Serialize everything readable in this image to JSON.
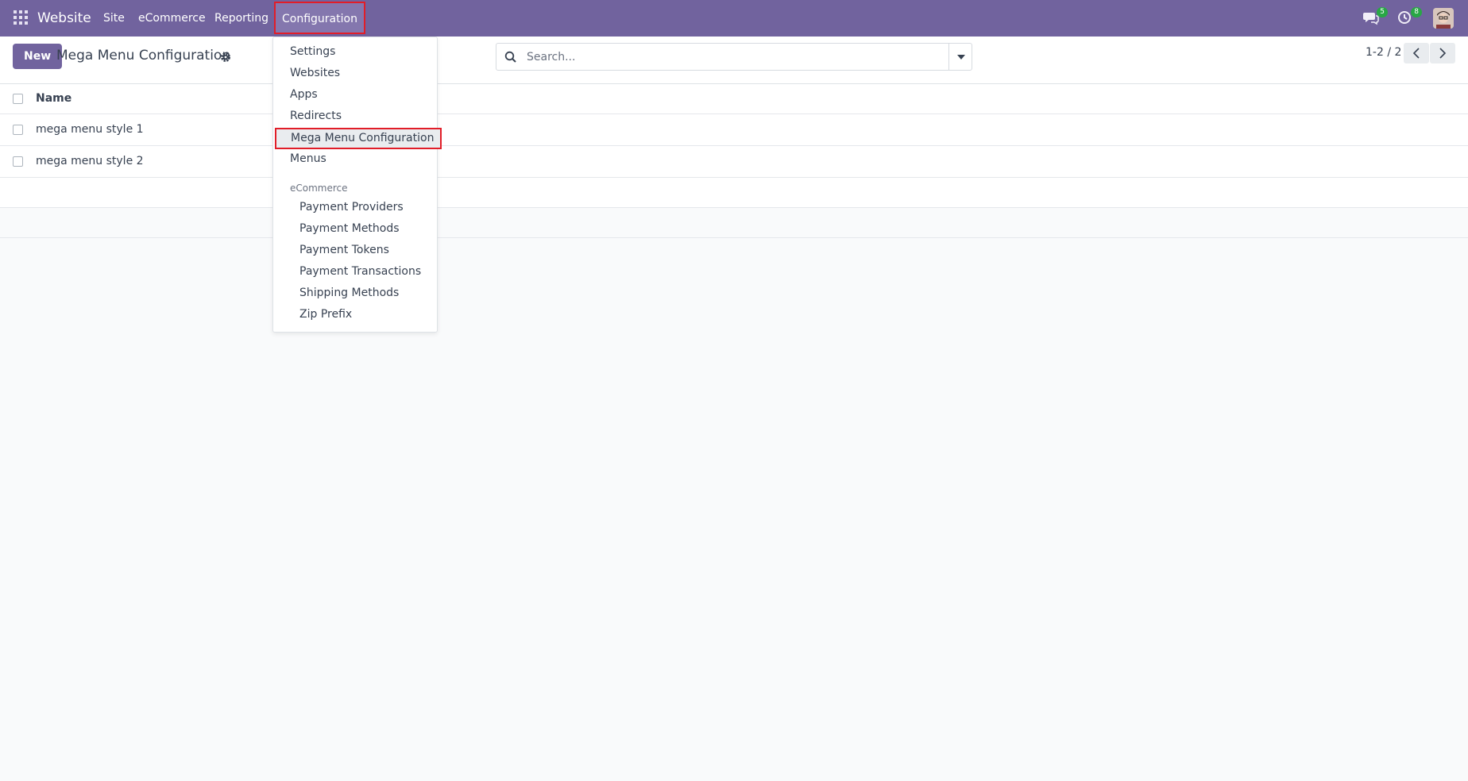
{
  "navbar": {
    "brand": "Website",
    "items": [
      "Site",
      "eCommerce",
      "Reporting",
      "Configuration"
    ],
    "active_item": "Configuration",
    "messages_badge": "5",
    "activities_badge": "8",
    "accent_color": "#71639e",
    "highlight_color": "#e11d28"
  },
  "control_panel": {
    "new_label": "New",
    "title": "Mega Menu Configuration",
    "search_placeholder": "Search...",
    "pager": "1-2 / 2"
  },
  "list": {
    "columns": [
      "Name"
    ],
    "rows": [
      {
        "name": "mega menu style 1"
      },
      {
        "name": "mega menu style 2"
      }
    ]
  },
  "dropdown": {
    "items": [
      "Settings",
      "Websites",
      "Apps",
      "Redirects",
      "Mega Menu Configuration",
      "Menus"
    ],
    "selected": "Mega Menu Configuration",
    "section_title": "eCommerce",
    "section_items": [
      "Payment Providers",
      "Payment Methods",
      "Payment Tokens",
      "Payment Transactions",
      "Shipping Methods",
      "Zip Prefix"
    ]
  }
}
